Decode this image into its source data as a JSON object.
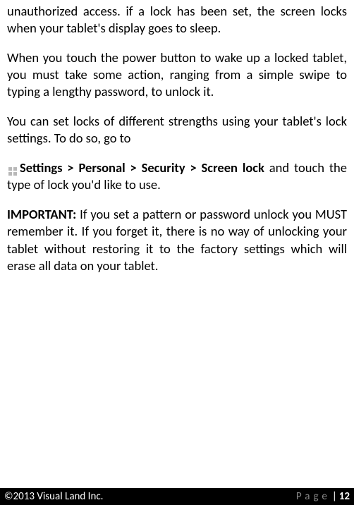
{
  "body": {
    "p1": "unauthorized access. if a lock has been set, the screen locks when your tablet's display goes to sleep.",
    "p2": "When you touch the power button to wake up a locked tablet, you must take some action, ranging from a simple swipe to typing a lengthy password, to unlock it.",
    "p3": "You can set locks of different strengths using your tablet's lock settings. To do so, go to",
    "p4_bold": "Settings > Personal > Security > Screen lock",
    "p4_rest": " and touch the type of lock you'd like to use.",
    "p5_bold": "IMPORTANT:",
    "p5_rest": " If you set a pattern or password unlock you MUST remember it. If you forget it, there is no way of unlocking your tablet without restoring it to the factory settings which will erase all data on your tablet."
  },
  "footer": {
    "copyright": "©2013 Visual Land Inc.",
    "page_label": "Page",
    "page_sep": "|",
    "page_number": "12"
  }
}
